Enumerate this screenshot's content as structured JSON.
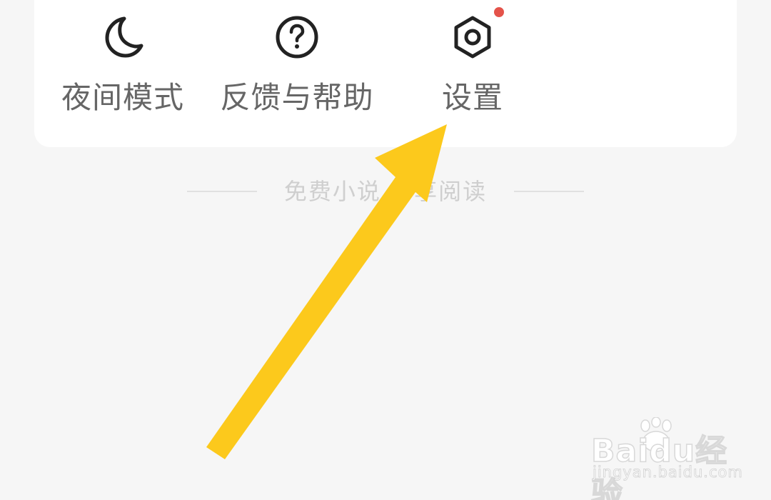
{
  "menu": {
    "items": [
      {
        "label": "夜间模式",
        "icon": "moon-icon"
      },
      {
        "label": "反馈与帮助",
        "icon": "question-circle-icon"
      },
      {
        "label": "设置",
        "icon": "settings-hexagon-icon",
        "has_badge": true
      }
    ]
  },
  "footer": {
    "slogan": "免费小说 畅享阅读"
  },
  "overlay": {
    "arrow_color": "#fcc91c",
    "arrow_target": "设置"
  },
  "watermark": {
    "brand": "Baidu经验",
    "url": "jingyan.baidu.com"
  },
  "colors": {
    "background": "#f6f6f6",
    "card": "#ffffff",
    "label": "#666666",
    "icon": "#222222",
    "badge": "#e4534a",
    "footer_text": "#cfcfcf"
  }
}
